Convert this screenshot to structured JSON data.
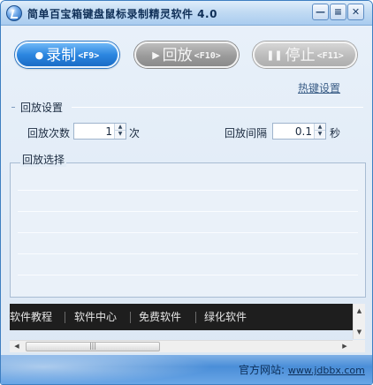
{
  "window": {
    "title": "简单百宝箱键盘鼠标录制精灵软件 4.0",
    "controls": {
      "minimize": "—",
      "menu": "≡",
      "close": "✕"
    }
  },
  "toolbar": {
    "record": {
      "label": "录制",
      "hotkey": "<F9>",
      "icon": "record-icon"
    },
    "replay": {
      "label": "回放",
      "hotkey": "<F10>",
      "icon": "play-icon"
    },
    "stop": {
      "label": "停止",
      "hotkey": "<F11>",
      "icon": "pause-icon"
    },
    "hotkey_settings": "热键设置"
  },
  "replay_settings": {
    "title": "回放设置",
    "count_label": "回放次数",
    "count_value": "1",
    "count_unit": "次",
    "interval_label": "回放间隔",
    "interval_value": "0.1",
    "interval_unit": "秒"
  },
  "replay_selection": {
    "title": "回放选择",
    "items": []
  },
  "nav_strip": {
    "items": [
      "软件教程",
      "软件中心",
      "免费软件",
      "绿化软件"
    ]
  },
  "footer": {
    "label": "官方网站:",
    "url": "www.jdbbx.com"
  },
  "colors": {
    "record_button": "#2c86e0",
    "disabled_button": "#9b9b9b",
    "nav_strip_bg": "#1e1e1e",
    "footer_bg": "#4a8ed8"
  }
}
